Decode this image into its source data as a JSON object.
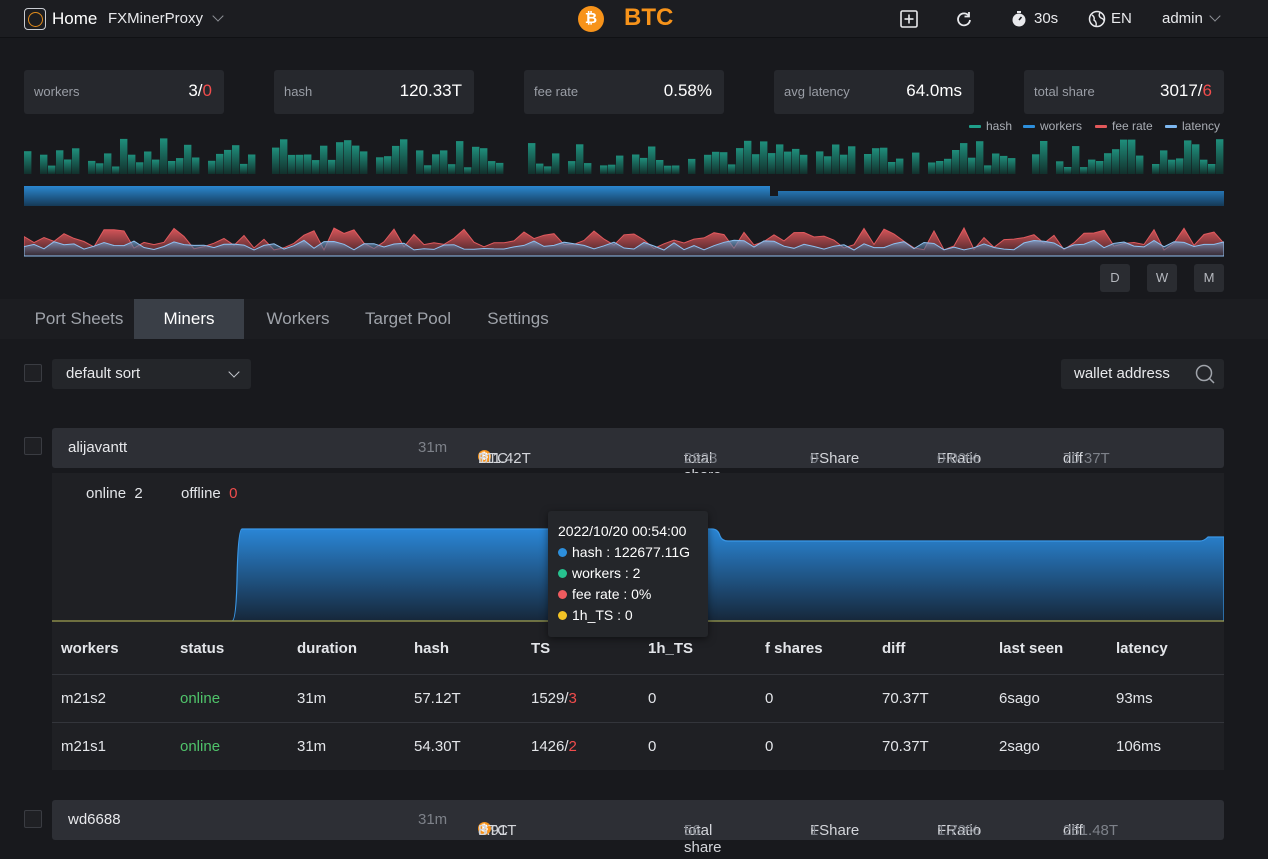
{
  "header": {
    "home": "Home",
    "proxy_name": "FXMinerProxy",
    "coin_badge": "₿",
    "coin": "BTC",
    "refresh_interval": "30s",
    "language": "EN",
    "user": "admin"
  },
  "stats": [
    {
      "label": "workers",
      "value": "3/",
      "value_red": "0"
    },
    {
      "label": "hash",
      "value": "120.33T",
      "value_red": ""
    },
    {
      "label": "fee rate",
      "value": "0.58%",
      "value_red": ""
    },
    {
      "label": "avg latency",
      "value": "64.0ms",
      "value_red": ""
    },
    {
      "label": "total share",
      "value": "3017/",
      "value_red": "6"
    }
  ],
  "legend": [
    {
      "name": "hash",
      "color": "#1f9f8a"
    },
    {
      "name": "workers",
      "color": "#2d8fdc"
    },
    {
      "name": "fee rate",
      "color": "#e2585a"
    },
    {
      "name": "latency",
      "color": "#7db7f0"
    }
  ],
  "range_buttons": [
    "D",
    "W",
    "M"
  ],
  "tabs": [
    "Port Sheets",
    "Miners",
    "Workers",
    "Target Pool",
    "Settings"
  ],
  "active_tab": "Miners",
  "controls": {
    "sort_value": "default sort",
    "search_placeholder": "wallet address"
  },
  "miners": [
    {
      "name": "alijavantt",
      "duration": "31m",
      "coin": "BTC",
      "hash": "111.42T",
      "total_share_label": "total share",
      "total_share": "2923",
      "fshare_label": "FShare",
      "fshare": "0",
      "fratio_label": "FRatio",
      "fratio": "0.00%",
      "diff_label": "diff",
      "diff": "70.37T"
    },
    {
      "name": "wd6688",
      "duration": "31m",
      "coin": "BTC",
      "hash": "8.91T",
      "total_share_label": "total share",
      "total_share": "56",
      "fshare_label": "FShare",
      "fshare": "1",
      "fratio_label": "FRatio",
      "fratio": "1.79%",
      "diff_label": "diff",
      "diff": "281.48T"
    }
  ],
  "detail": {
    "online_label": "online",
    "online": "2",
    "offline_label": "offline",
    "offline": "0",
    "tooltip": {
      "time": "2022/10/20 00:54:00",
      "hash": "hash : 122677.11G",
      "workers": "workers : 2",
      "fee_rate": "fee rate : 0%",
      "ts_1h": "1h_TS : 0"
    },
    "columns": [
      "workers",
      "status",
      "duration",
      "hash",
      "TS",
      "1h_TS",
      "f shares",
      "diff",
      "last seen",
      "latency"
    ],
    "rows": [
      {
        "worker": "m21s2",
        "status": "online",
        "duration": "31m",
        "hash": "57.12T",
        "ts": "1529/",
        "ts_red": "3",
        "ts_1h": "0",
        "f_shares": "0",
        "diff": "70.37T",
        "last_seen": "6sago",
        "latency": "93ms"
      },
      {
        "worker": "m21s1",
        "status": "online",
        "duration": "31m",
        "hash": "54.30T",
        "ts": "1426/",
        "ts_red": "2",
        "ts_1h": "0",
        "f_shares": "0",
        "diff": "70.37T",
        "last_seen": "2sago",
        "latency": "106ms"
      }
    ]
  }
}
